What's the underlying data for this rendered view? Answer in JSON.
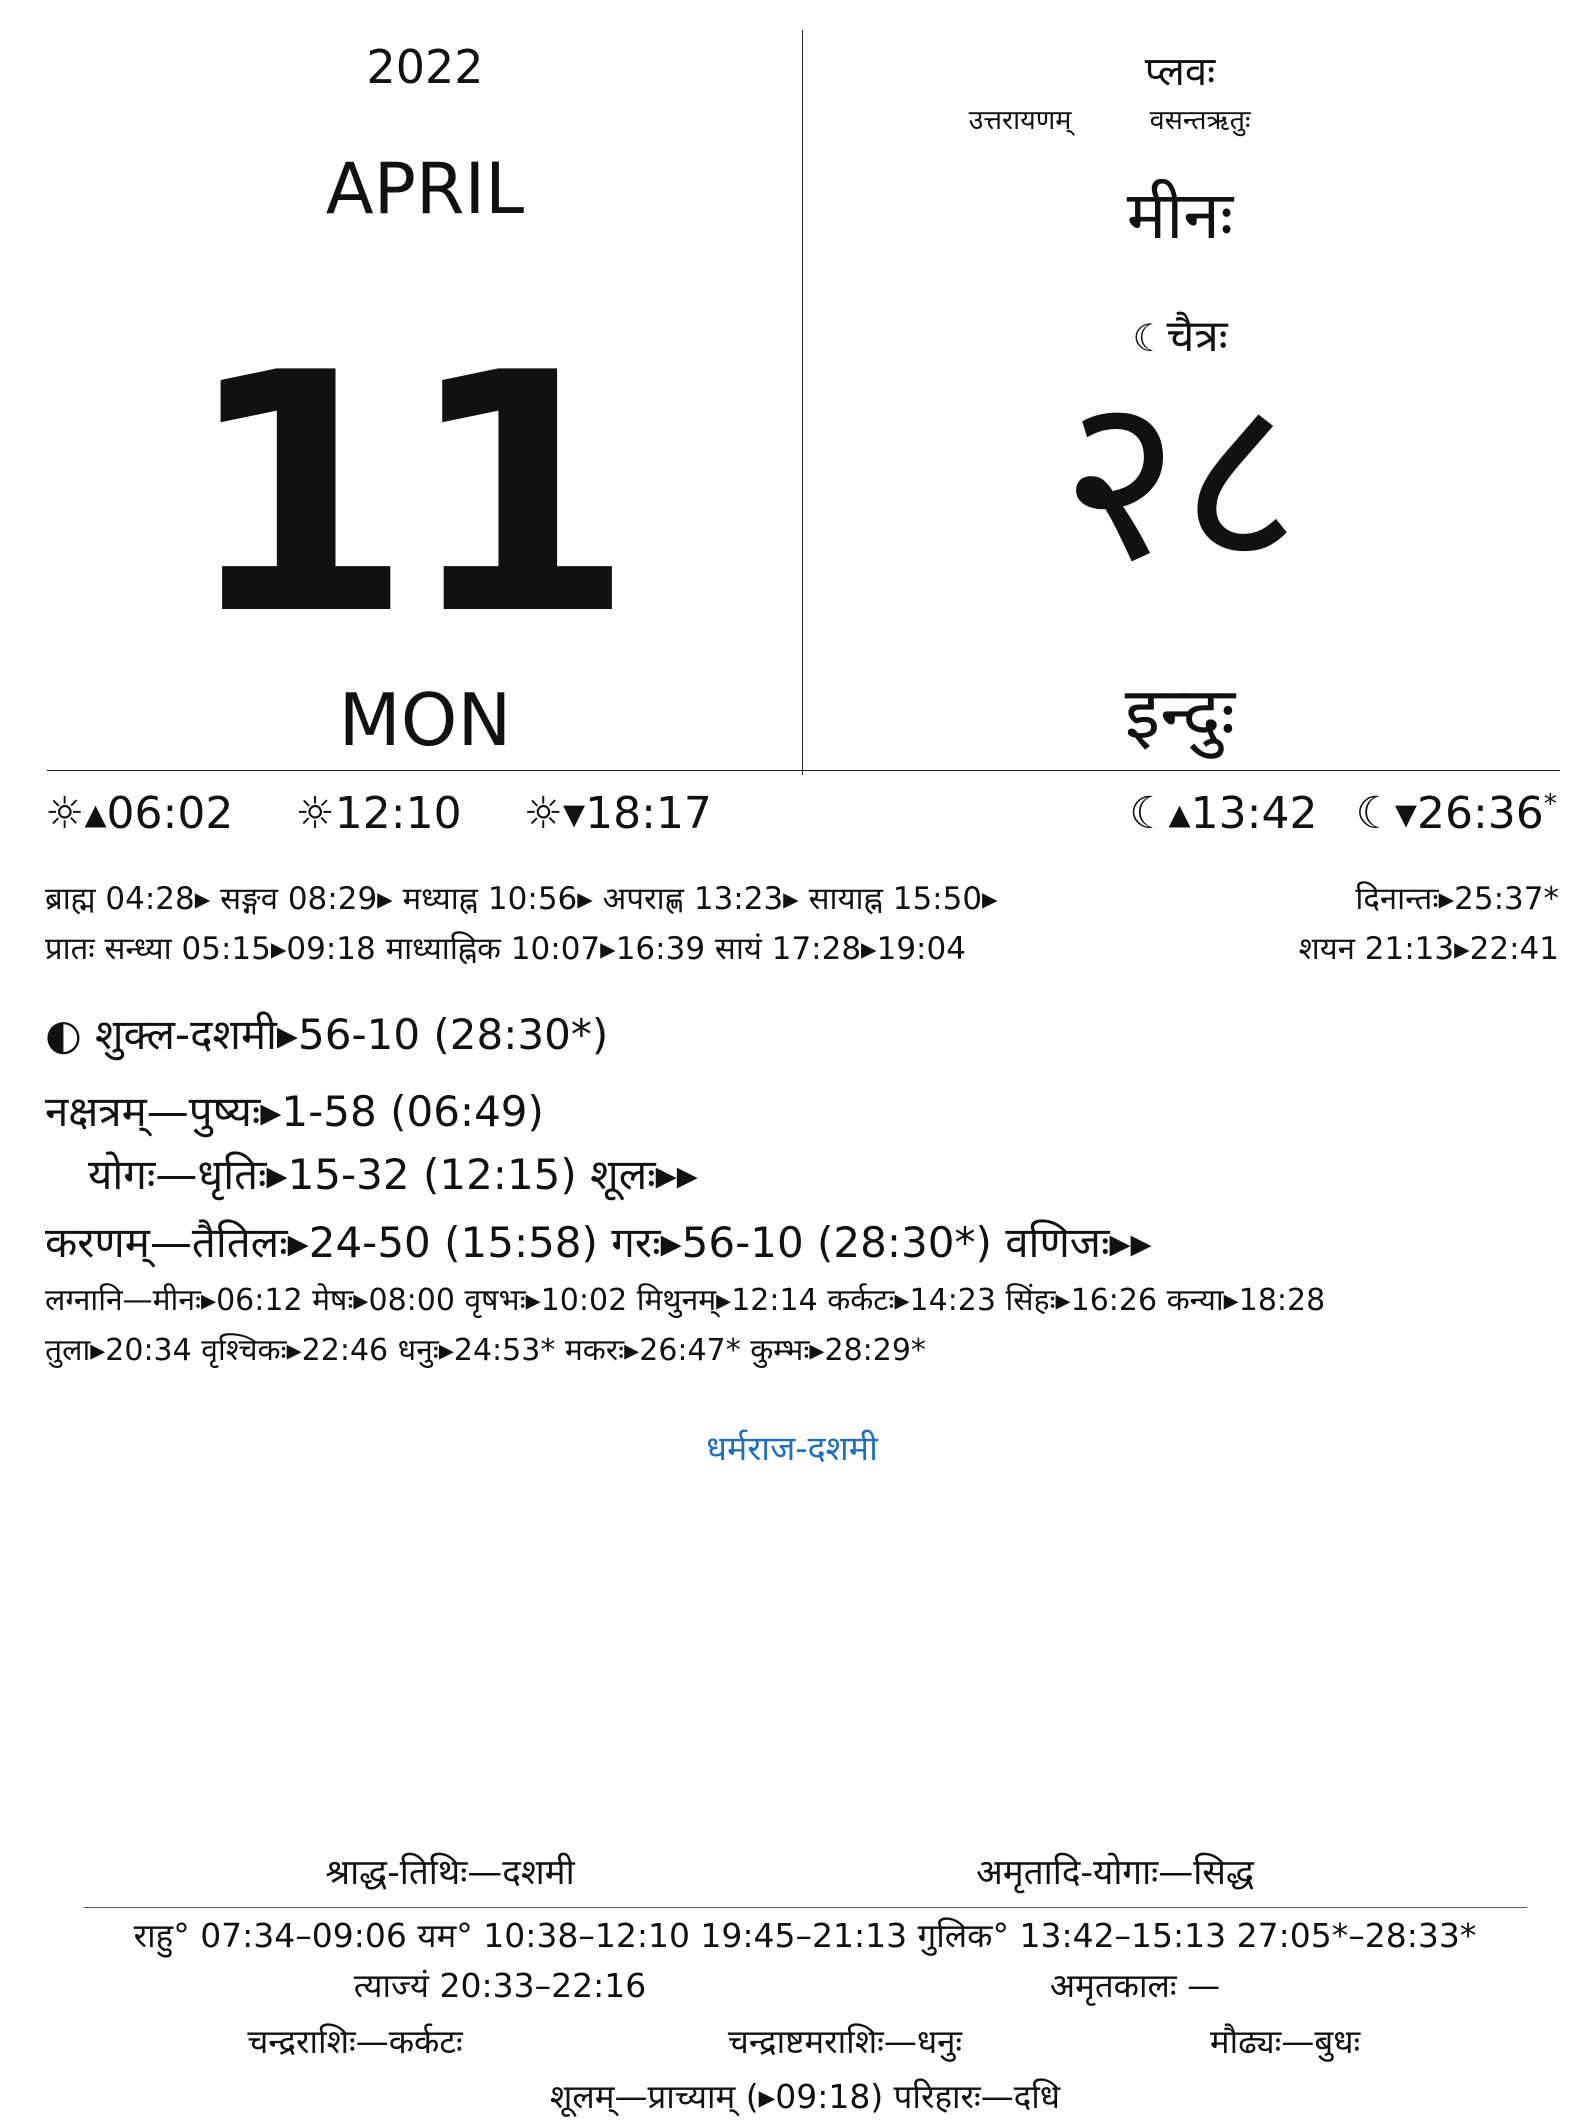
{
  "gregorian": {
    "year": "2022",
    "month": "APRIL",
    "day": "11",
    "weekday": "MON"
  },
  "panchanga_header": {
    "samvatsara": "प्लवः",
    "ayana": "उत्तरायणम्",
    "rtu": "वसन्तऋतुः",
    "rashi": "मीनः",
    "masa": "चैत्रः",
    "masa_icon": "☾",
    "tithi_number": "२८",
    "vara": "इन्दुः"
  },
  "sun": {
    "sunrise": "☼▴06:02",
    "noon": "☼12:10",
    "sunset": "☼▾18:17"
  },
  "moon": {
    "moonrise": "☾▴13:42",
    "moonset": "☾▾26:36",
    "moonset_mark": "*"
  },
  "kala": {
    "line1": "ब्राह्म 04:28▸ सङ्गव 08:29▸ मध्याह्न 10:56▸ अपराह्ण 13:23▸ सायाह्न 15:50▸",
    "line2": "प्रातः सन्ध्या 05:15▸09:18 माध्याह्निक 10:07▸16:39 सायं 17:28▸19:04",
    "dinanta": "दिनान्तः▸25:37*",
    "shayana": "शयन 21:13▸22:41"
  },
  "panchanga": {
    "tithi": "◐ शुक्ल-दशमी▸56-10 (28:30*)",
    "nakshatra": "नक्षत्रम्—पुष्यः▸1-58 (06:49)",
    "yoga": "योगः—धृतिः▸15-32 (12:15)  शूलः▸▸",
    "karana": "करणम्—तैतिलः▸24-50 (15:58)  गरः▸56-10 (28:30*)  वणिजः▸▸",
    "lagna1": "लग्नानि—मीनः▸06:12  मेषः▸08:00  वृषभः▸10:02  मिथुनम्▸12:14  कर्कटः▸14:23  सिंहः▸16:26  कन्या▸18:28",
    "lagna2": "तुला▸20:34  वृश्चिकः▸22:46  धनुः▸24:53*  मकरः▸26:47*  कुम्भः▸28:29*"
  },
  "festival": "धर्मराज-दशमी",
  "footer": {
    "shraddha": "श्राद्ध-तिथिः—दशमी",
    "amritadi": "अमृतादि-योगाः—सिद्ध",
    "rahu_row": "राहु° 07:34–09:06   यम° 10:38–12:10 19:45–21:13   गुलिक° 13:42–15:13 27:05*–28:33*",
    "tyajyam": "त्याज्यं 20:33–22:16",
    "amritakala": "अमृतकालः —",
    "chandrarashi": "चन्द्रराशिः—कर्कटः",
    "chandrashtama": "चन्द्राष्टमराशिः—धनुः",
    "maudhya": "मौढ्यः—बुधः",
    "shulam": "शूलम्—प्राच्याम् (▸09:18) परिहारः—दधि"
  },
  "colors": {
    "festival": "#1f6fbf",
    "text": "#111111",
    "rule": "#222222"
  }
}
